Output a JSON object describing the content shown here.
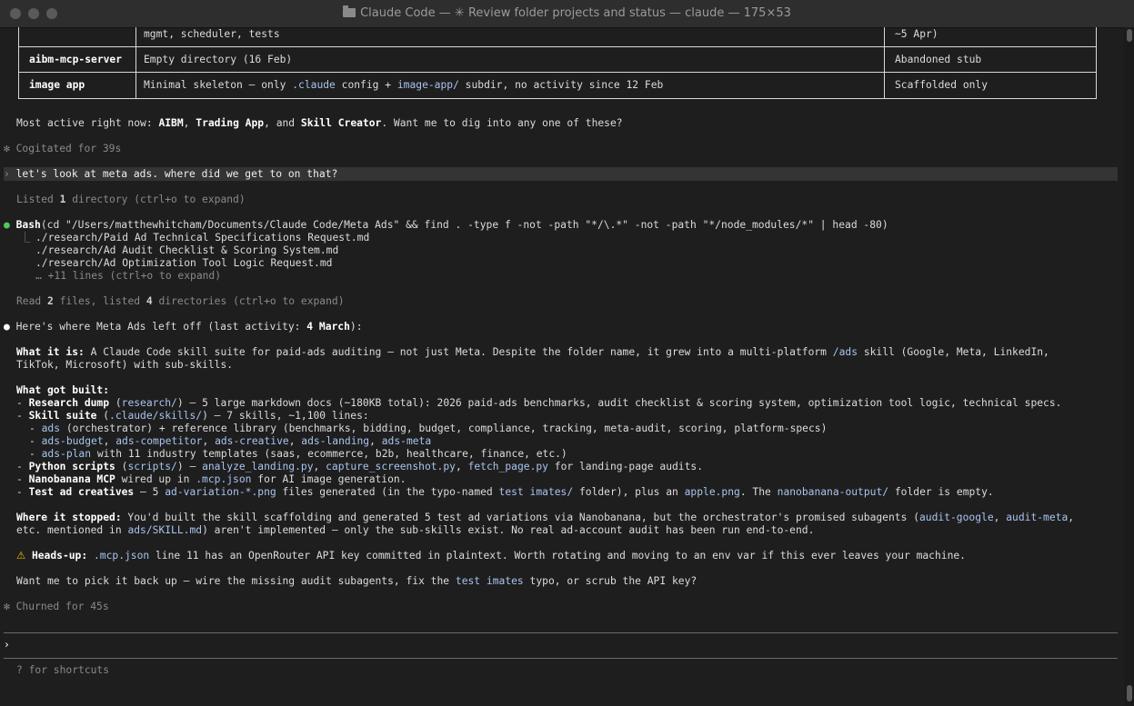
{
  "window": {
    "title": "Claude Code — ✳ Review folder projects and status — claude — 175×53"
  },
  "table": {
    "rows": [
      {
        "name": "",
        "desc": "mgmt, scheduler, tests",
        "status": "~5 Apr)"
      },
      {
        "name": "aibm-mcp-server",
        "desc": "Empty directory (16 Feb)",
        "status": "Abandoned stub"
      },
      {
        "name": "image app",
        "desc_a": "Minimal skeleton — only ",
        "desc_link1": ".claude",
        "desc_b": " config + ",
        "desc_link2": "image-app/",
        "desc_c": " subdir, no activity since 12 Feb",
        "status": "Scaffolded only"
      }
    ]
  },
  "summary": {
    "a": "Most active right now: ",
    "p1": "AIBM",
    "c1": ", ",
    "p2": "Trading App",
    "c2": ", and ",
    "p3": "Skill Creator",
    "tail": ". Want me to dig into any one of these?"
  },
  "cogitated": {
    "star": "✻",
    "text": "Cogitated for 39s"
  },
  "prompt": {
    "marker": "›",
    "text": "let's look at meta ads. where did we get to on that?"
  },
  "listed": {
    "a": "Listed ",
    "n": "1",
    "b": " directory (ctrl+o to expand)"
  },
  "bash": {
    "bullet": "●",
    "label": "Bash",
    "cmd": "(cd \"/Users/matthewhitcham/Documents/Claude Code/Meta Ads\" && find . -type f -not -path \"*/\\.*\" -not -path \"*/node_modules/*\" | head -80)",
    "branch": "⎿",
    "lines": [
      "./research/Paid Ad Technical Specifications Request.md",
      "./research/Ad Audit Checklist & Scoring System.md",
      "./research/Ad Optimization Tool Logic Request.md"
    ],
    "more": "… +11 lines (ctrl+o to expand)"
  },
  "read": {
    "a": "Read ",
    "n1": "2",
    "b": " files, listed ",
    "n2": "4",
    "c": " directories (ctrl+o to expand)"
  },
  "reply": {
    "bullet": "●",
    "intro": "Here's where Meta Ads left off (last activity: ",
    "intro_date": "4 March",
    "intro_end": "):",
    "what_label": "What it is:",
    "what_1": " A Claude Code skill suite for paid-ads auditing — not just Meta. Despite the folder name, it grew into a multi-platform ",
    "what_link": "/ads",
    "what_2": " skill (Google, Meta, LinkedIn,",
    "what_3": "TikTok, Microsoft) with sub-skills.",
    "built_label": "What got built:",
    "research_label": "Research dump",
    "research_path": "research/",
    "research_text": ") — 5 large markdown docs (~180KB total): 2026 paid-ads benchmarks, audit checklist & scoring system, optimization tool logic, technical specs.",
    "skill_label": "Skill suite",
    "skill_path": ".claude/skills/",
    "skill_text": ") — 7 skills, ~1,100 lines:",
    "ads_link": "ads",
    "ads_text": " (orchestrator) + reference library (benchmarks, bidding, budget, compliance, tracking, meta-audit, scoring, platform-specs)",
    "sub_skills": [
      "ads-budget",
      "ads-competitor",
      "ads-creative",
      "ads-landing",
      "ads-meta"
    ],
    "plan_link": "ads-plan",
    "plan_text": " with 11 industry templates (saas, ecommerce, b2b, healthcare, finance, etc.)",
    "python_label": "Python scripts",
    "python_path": "scripts/",
    "python_files": [
      "analyze_landing.py",
      "capture_screenshot.py",
      "fetch_page.py"
    ],
    "python_tail": " for landing-page audits.",
    "nano_label": "Nanobanana MCP",
    "nano_a": " wired up in ",
    "nano_link": ".mcp.json",
    "nano_b": " for AI image generation.",
    "test_label": "Test ad creatives",
    "test_a": " — 5 ",
    "test_link1": "ad-variation-*.png",
    "test_b": " files generated (in the typo-named ",
    "test_link2": "test imates/",
    "test_c": " folder), plus an ",
    "test_link3": "apple.png",
    "test_d": ". The ",
    "test_link4": "nanobanana-output/",
    "test_e": " folder is empty.",
    "stop_label": "Where it stopped:",
    "stop_a": " You'd built the skill scaffolding and generated 5 test ad variations via Nanobanana, but the orchestrator's promised subagents (",
    "stop_link1": "audit-google",
    "stop_comma": ", ",
    "stop_link2": "audit-meta",
    "stop_b": ",",
    "stop_c": "etc. mentioned in ",
    "stop_link3": "ads/SKILL.md",
    "stop_d": ") aren't implemented — only the sub-skills exist. No real ad-account audit has been run end-to-end.",
    "warn_icon": "⚠️",
    "warn_label": "Heads-up:",
    "warn_link": ".mcp.json",
    "warn_text": " line 11 has an OpenRouter API key committed in plaintext. Worth rotating and moving to an env var if this ever leaves your machine.",
    "ask_a": "Want me to pick it back up — wire the missing audit subagents, fix the ",
    "ask_link": "test imates",
    "ask_b": " typo, or scrub the API key?"
  },
  "churned": {
    "star": "✻",
    "text": "Churned for 45s"
  },
  "input": {
    "caret": "›",
    "value": ""
  },
  "footer": {
    "hint": "? for shortcuts"
  },
  "colors": {
    "accent_green": "#4ec95c",
    "link": "#a9c4ef",
    "background": "#1e1e1e"
  }
}
